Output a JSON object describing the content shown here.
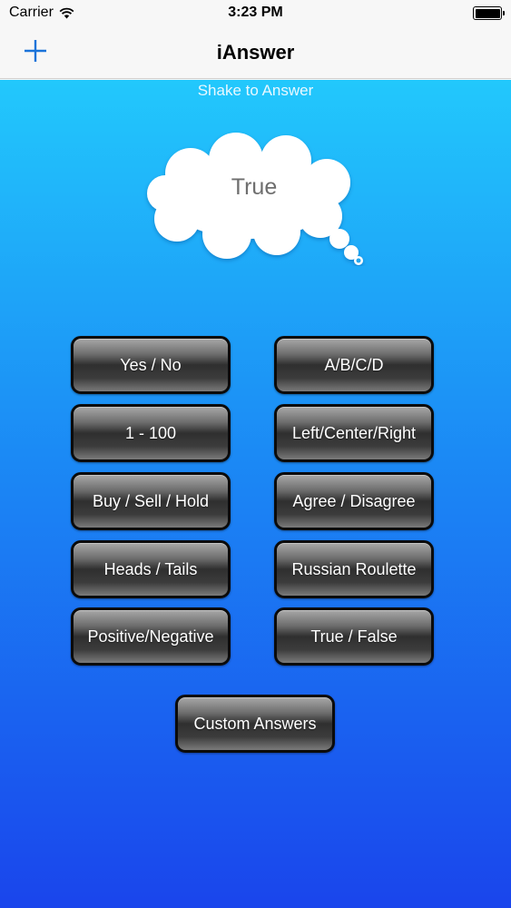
{
  "status_bar": {
    "carrier": "Carrier",
    "time": "3:23 PM",
    "battery_level": 1.0
  },
  "nav": {
    "title": "iAnswer",
    "add_icon": "plus-icon",
    "accent_color": "#1a73d9"
  },
  "main": {
    "shake_label": "Shake to Answer",
    "answer": "True",
    "buttons": [
      "Yes / No",
      "A/B/C/D",
      "1 - 100",
      "Left/Center/Right",
      "Buy / Sell / Hold",
      "Agree / Disagree",
      "Heads / Tails",
      "Russian Roulette",
      "Positive/Negative",
      "True / False"
    ],
    "custom_button": "Custom Answers"
  },
  "colors": {
    "background_top": "#22c8fc",
    "background_bottom": "#1a45ec",
    "button_text": "#ffffff",
    "cloud_text": "#6e6e6e"
  }
}
